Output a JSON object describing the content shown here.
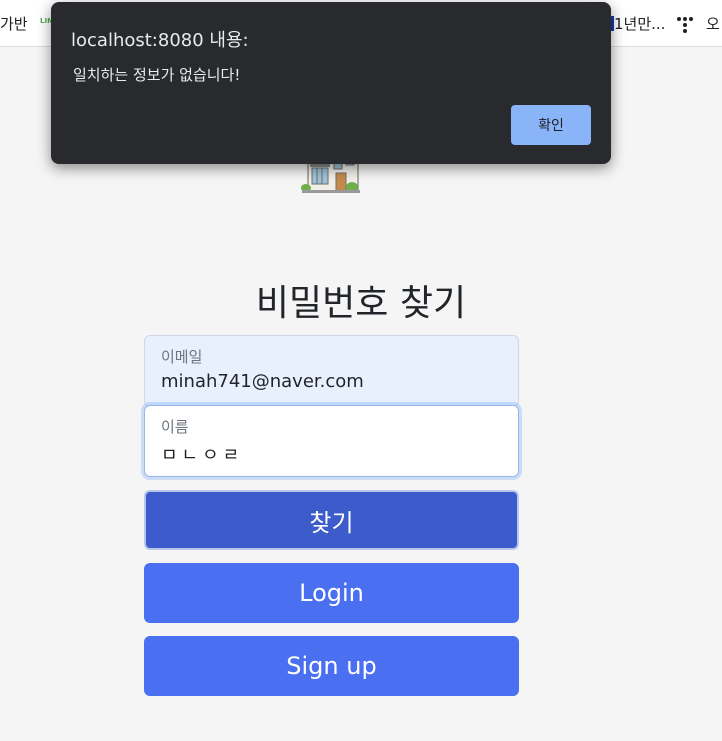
{
  "bookmarks": {
    "left_fragment": "가반",
    "line_label": "LINE",
    "right_fragment": "1년만...",
    "far_right_fragment": "오"
  },
  "page": {
    "title": "비밀번호 찾기",
    "logo_icon": "house-illustration-icon",
    "email": {
      "label": "이메일",
      "value": "minah741@naver.com"
    },
    "name": {
      "label": "이름",
      "value": "ㅁㄴㅇㄹ"
    },
    "buttons": {
      "find": "찾기",
      "login": "Login",
      "signup": "Sign up"
    }
  },
  "dialog": {
    "title": "localhost:8080 내용:",
    "message": "일치하는 정보가 없습니다!",
    "confirm": "확인"
  },
  "colors": {
    "primary": "#4a6ff0",
    "primary_active": "#3c5ccc",
    "dialog_bg": "#292a2d",
    "dialog_button": "#8ab4f8"
  }
}
